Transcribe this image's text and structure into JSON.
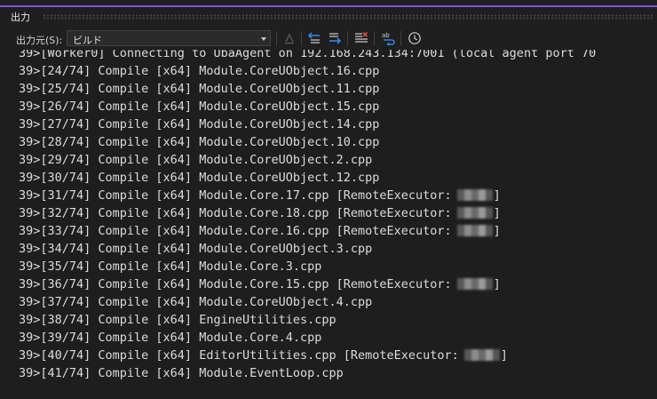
{
  "panel": {
    "title": "出力"
  },
  "toolbar": {
    "source_label": "出力元(S):",
    "source_value": "ビルド"
  },
  "icons": {
    "find_message": "find-message-icon",
    "prev_message": "go-to-previous-message-icon",
    "next_message": "go-to-next-message-icon",
    "clear_all": "clear-all-icon",
    "word_wrap": "toggle-word-wrap-icon",
    "timestamps": "show-timestamps-icon"
  },
  "output_lines": [
    {
      "text": "39>[Worker0] Connecting to UbaAgent on 192.168.243.134:7001 (local agent port 70",
      "redacted": false
    },
    {
      "text": "39>[24/74] Compile [x64] Module.CoreUObject.16.cpp",
      "redacted": false
    },
    {
      "text": "39>[25/74] Compile [x64] Module.CoreUObject.11.cpp",
      "redacted": false
    },
    {
      "text": "39>[26/74] Compile [x64] Module.CoreUObject.15.cpp",
      "redacted": false
    },
    {
      "text": "39>[27/74] Compile [x64] Module.CoreUObject.14.cpp",
      "redacted": false
    },
    {
      "text": "39>[28/74] Compile [x64] Module.CoreUObject.10.cpp",
      "redacted": false
    },
    {
      "text": "39>[29/74] Compile [x64] Module.CoreUObject.2.cpp",
      "redacted": false
    },
    {
      "text": "39>[30/74] Compile [x64] Module.CoreUObject.12.cpp",
      "redacted": false
    },
    {
      "text": "39>[31/74] Compile [x64] Module.Core.17.cpp [RemoteExecutor:",
      "redacted": true,
      "suffix": "]"
    },
    {
      "text": "39>[32/74] Compile [x64] Module.Core.18.cpp [RemoteExecutor:",
      "redacted": true,
      "suffix": "]"
    },
    {
      "text": "39>[33/74] Compile [x64] Module.Core.16.cpp [RemoteExecutor:",
      "redacted": true,
      "suffix": "]"
    },
    {
      "text": "39>[34/74] Compile [x64] Module.CoreUObject.3.cpp",
      "redacted": false
    },
    {
      "text": "39>[35/74] Compile [x64] Module.Core.3.cpp",
      "redacted": false
    },
    {
      "text": "39>[36/74] Compile [x64] Module.Core.15.cpp [RemoteExecutor:",
      "redacted": true,
      "suffix": "]"
    },
    {
      "text": "39>[37/74] Compile [x64] Module.CoreUObject.4.cpp",
      "redacted": false
    },
    {
      "text": "39>[38/74] Compile [x64] EngineUtilities.cpp",
      "redacted": false
    },
    {
      "text": "39>[39/74] Compile [x64] Module.Core.4.cpp",
      "redacted": false
    },
    {
      "text": "39>[40/74] Compile [x64] EditorUtilities.cpp [RemoteExecutor:",
      "redacted": true,
      "suffix": "]"
    },
    {
      "text": "39>[41/74] Compile [x64] Module.EventLoop.cpp",
      "redacted": false
    }
  ],
  "colors": {
    "background": "#1e1e1e",
    "panel_background": "#1f1f1f",
    "text": "#dcdcdc",
    "accent": "#8a4fd6",
    "icon_blue": "#3794ff",
    "icon_red": "#f14c4c"
  }
}
